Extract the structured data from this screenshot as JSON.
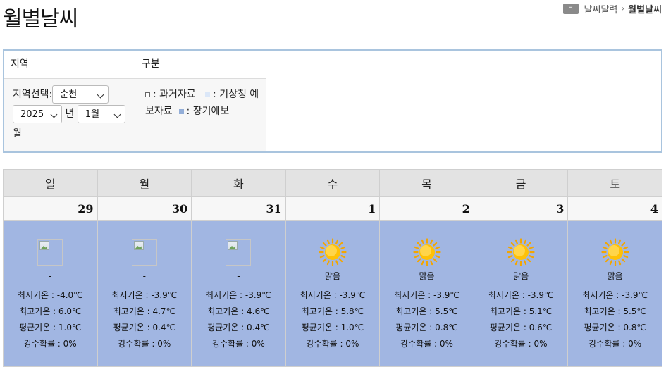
{
  "page": {
    "title": "월별날씨"
  },
  "breadcrumb": {
    "home_icon": "home-icon",
    "home_label": "H",
    "parent": "날씨달력",
    "current": "월별날씨"
  },
  "filter": {
    "region_header": "지역",
    "category_header": "구분",
    "region_label": "지역선택:",
    "region_value": "순천",
    "year_value": "2025",
    "year_suffix": "년",
    "month_value": "1월",
    "month_suffix": "월",
    "legend": {
      "past": ": 과거자료",
      "short_term": ": 기상청 예보자료",
      "long_term": ": 장기예보"
    },
    "colors": {
      "frame": "#a9c4de",
      "short_term": "#dbe7f8",
      "long_term": "#93aed8"
    }
  },
  "calendar": {
    "weekdays": [
      "일",
      "월",
      "화",
      "수",
      "목",
      "금",
      "토"
    ],
    "labels": {
      "min": "최저기온 : ",
      "max": "최고기온 : ",
      "avg": "평균기온 : ",
      "rain": "강수확률 : "
    },
    "days": [
      {
        "date": "29",
        "icon": "broken-image-icon",
        "condition": "-",
        "min": "-4.0℃",
        "max": "6.0℃",
        "avg": "1.0℃",
        "rain": "0%"
      },
      {
        "date": "30",
        "icon": "broken-image-icon",
        "condition": "-",
        "min": "-3.9℃",
        "max": "4.7℃",
        "avg": "0.4℃",
        "rain": "0%"
      },
      {
        "date": "31",
        "icon": "broken-image-icon",
        "condition": "-",
        "min": "-3.9℃",
        "max": "4.6℃",
        "avg": "0.4℃",
        "rain": "0%"
      },
      {
        "date": "1",
        "icon": "sun-icon",
        "condition": "맑음",
        "min": "-3.9℃",
        "max": "5.8℃",
        "avg": "1.0℃",
        "rain": "0%"
      },
      {
        "date": "2",
        "icon": "sun-icon",
        "condition": "맑음",
        "min": "-3.9℃",
        "max": "5.5℃",
        "avg": "0.8℃",
        "rain": "0%"
      },
      {
        "date": "3",
        "icon": "sun-icon",
        "condition": "맑음",
        "min": "-3.9℃",
        "max": "5.1℃",
        "avg": "0.6℃",
        "rain": "0%"
      },
      {
        "date": "4",
        "icon": "sun-icon",
        "condition": "맑음",
        "min": "-3.9℃",
        "max": "5.5℃",
        "avg": "0.8℃",
        "rain": "0%"
      }
    ],
    "colors": {
      "sunday": "#e60000",
      "saturday": "#0000cc",
      "cell_bg": "#a1b6e2"
    }
  }
}
